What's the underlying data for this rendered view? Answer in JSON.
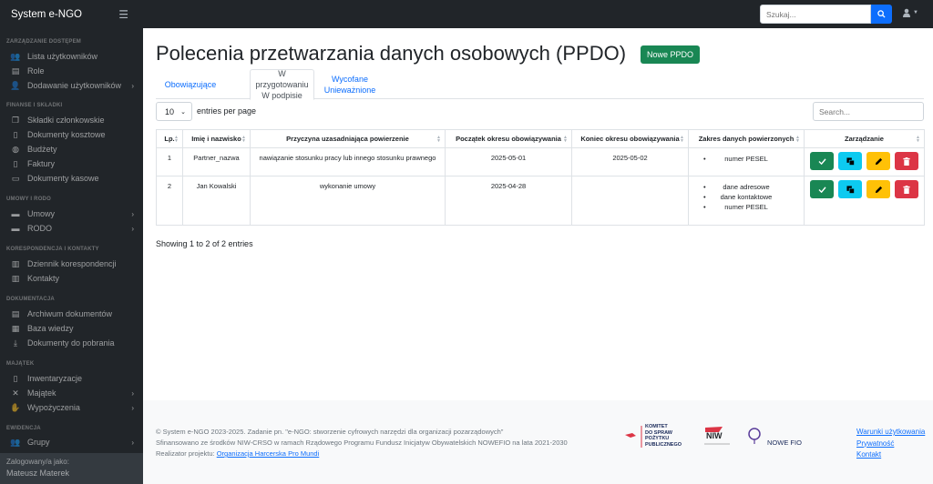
{
  "topbar": {
    "brand": "System e-NGO",
    "search_placeholder": "Szukaj..."
  },
  "sidebar": {
    "sections": [
      {
        "heading": "ZARZĄDZANIE DOSTĘPEM",
        "items": [
          "Lista użytkowników",
          "Role",
          "Dodawanie użytkowników"
        ]
      },
      {
        "heading": "FINANSE I SKŁADKI",
        "items": [
          "Składki członkowskie",
          "Dokumenty kosztowe",
          "Budżety",
          "Faktury",
          "Dokumenty kasowe"
        ]
      },
      {
        "heading": "UMOWY I RODO",
        "items": [
          "Umowy",
          "RODO"
        ]
      },
      {
        "heading": "KORESPONDENCJA I KONTAKTY",
        "items": [
          "Dziennik korespondencji",
          "Kontakty"
        ]
      },
      {
        "heading": "DOKUMENTACJA",
        "items": [
          "Archiwum dokumentów",
          "Baza wiedzy",
          "Dokumenty do pobrania"
        ]
      },
      {
        "heading": "MAJĄTEK",
        "items": [
          "Inwentaryzacje",
          "Majątek",
          "Wypożyczenia"
        ]
      },
      {
        "heading": "EWIDENCJA",
        "items": [
          "Grupy"
        ]
      }
    ],
    "logged_label": "Zalogowany/a jako:",
    "logged_user": "Mateusz Materek"
  },
  "main": {
    "title": "Polecenia przetwarzania danych osobowych (PPDO)",
    "new_button": "Nowe PPDO",
    "tabs": [
      {
        "line1": "Obowiązujące",
        "line2": ""
      },
      {
        "line1": "W przygotowaniu",
        "line2": "W podpisie"
      },
      {
        "line1": "Wycofane",
        "line2": "Unieważnione"
      }
    ],
    "length_value": "10",
    "length_label": "entries per page",
    "table_search_placeholder": "Search...",
    "columns": [
      "Lp.",
      "Imię i nazwisko",
      "Przyczyna uzasadniająca powierzenie",
      "Początek okresu obowiązywania",
      "Koniec okresu obowiązywania",
      "Zakres danych powierzonych",
      "Zarządzanie"
    ],
    "rows": [
      {
        "lp": "1",
        "name": "Partner_nazwa",
        "reason": "nawiązanie stosunku pracy lub innego stosunku prawnego",
        "start": "2025-05-01",
        "end": "2025-05-02",
        "scope": [
          "numer PESEL"
        ]
      },
      {
        "lp": "2",
        "name": "Jan Kowalski",
        "reason": "wykonanie umowy",
        "start": "2025-04-28",
        "end": "",
        "scope": [
          "dane adresowe",
          "dane kontaktowe",
          "numer PESEL"
        ]
      }
    ],
    "info": "Showing 1 to 2 of 2 entries"
  },
  "footer": {
    "line1": "© System e-NGO 2023-2025. Zadanie pn. \"e-NGO: stworzenie cyfrowych narzędzi dla organizacji pozarządowych\"",
    "line2": "Sfinansowano ze środków NIW-CRSO w ramach Rządowego Programu Fundusz Inicjatyw Obywatelskich NOWEFIO na lata 2021-2030",
    "line3_prefix": "Realizator projektu: ",
    "line3_link": "Organizacja Harcerska Pro Mundi",
    "logo1_lines": [
      "KOMITET",
      "DO SPRAW",
      "POŻYTKU",
      "PUBLICZNEGO"
    ],
    "logo2_text": "NIW",
    "logo3_text": "NOWE FIO",
    "links": [
      "Warunki użytkowania",
      "Prywatność",
      "Kontakt"
    ]
  },
  "colors": {
    "primary": "#0d6efd",
    "success": "#198754",
    "info": "#0dcaf0",
    "warning": "#ffc107",
    "danger": "#dc3545",
    "dark": "#212529"
  }
}
